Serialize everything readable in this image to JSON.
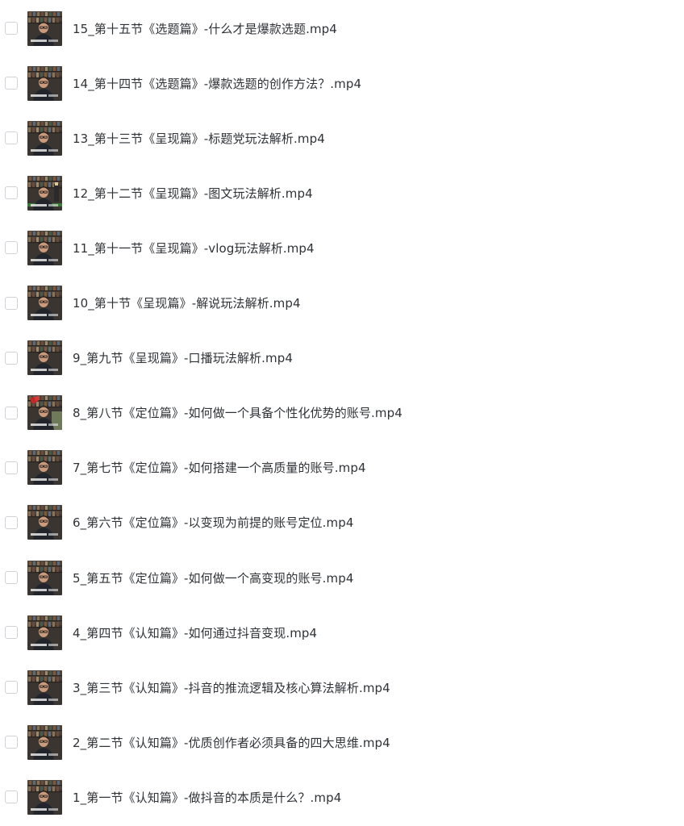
{
  "files": [
    {
      "name": "15_第十五节《选题篇》-什么才是爆款选题.mp4",
      "thumb_variant": "a"
    },
    {
      "name": "14_第十四节《选题篇》-爆款选题的创作方法？.mp4",
      "thumb_variant": "a"
    },
    {
      "name": "13_第十三节《呈现篇》-标题党玩法解析.mp4",
      "thumb_variant": "a"
    },
    {
      "name": "12_第十二节《呈现篇》-图文玩法解析.mp4",
      "thumb_variant": "c"
    },
    {
      "name": "11_第十一节《呈现篇》-vlog玩法解析.mp4",
      "thumb_variant": "a"
    },
    {
      "name": "10_第十节《呈现篇》-解说玩法解析.mp4",
      "thumb_variant": "a"
    },
    {
      "name": "9_第九节《呈现篇》-口播玩法解析.mp4",
      "thumb_variant": "a"
    },
    {
      "name": "8_第八节《定位篇》-如何做一个具备个性化优势的账号.mp4",
      "thumb_variant": "b"
    },
    {
      "name": "7_第七节《定位篇》-如何搭建一个高质量的账号.mp4",
      "thumb_variant": "a"
    },
    {
      "name": "6_第六节《定位篇》-以变现为前提的账号定位.mp4",
      "thumb_variant": "a"
    },
    {
      "name": "5_第五节《定位篇》-如何做一个高变现的账号.mp4",
      "thumb_variant": "a"
    },
    {
      "name": "4_第四节《认知篇》-如何通过抖音变现.mp4",
      "thumb_variant": "a"
    },
    {
      "name": "3_第三节《认知篇》-抖音的推流逻辑及核心算法解析.mp4",
      "thumb_variant": "a"
    },
    {
      "name": "2_第二节《认知篇》-优质创作者必须具备的四大思维.mp4",
      "thumb_variant": "a"
    },
    {
      "name": "1_第一节《认知篇》-做抖音的本质是什么？.mp4",
      "thumb_variant": "a"
    }
  ],
  "colors": {
    "text": "#2f3337",
    "checkbox_border": "#cfd3d9",
    "background": "#ffffff"
  },
  "icons": {
    "thumbnail": "video-thumbnail-icon",
    "checkbox": "checkbox-icon"
  }
}
